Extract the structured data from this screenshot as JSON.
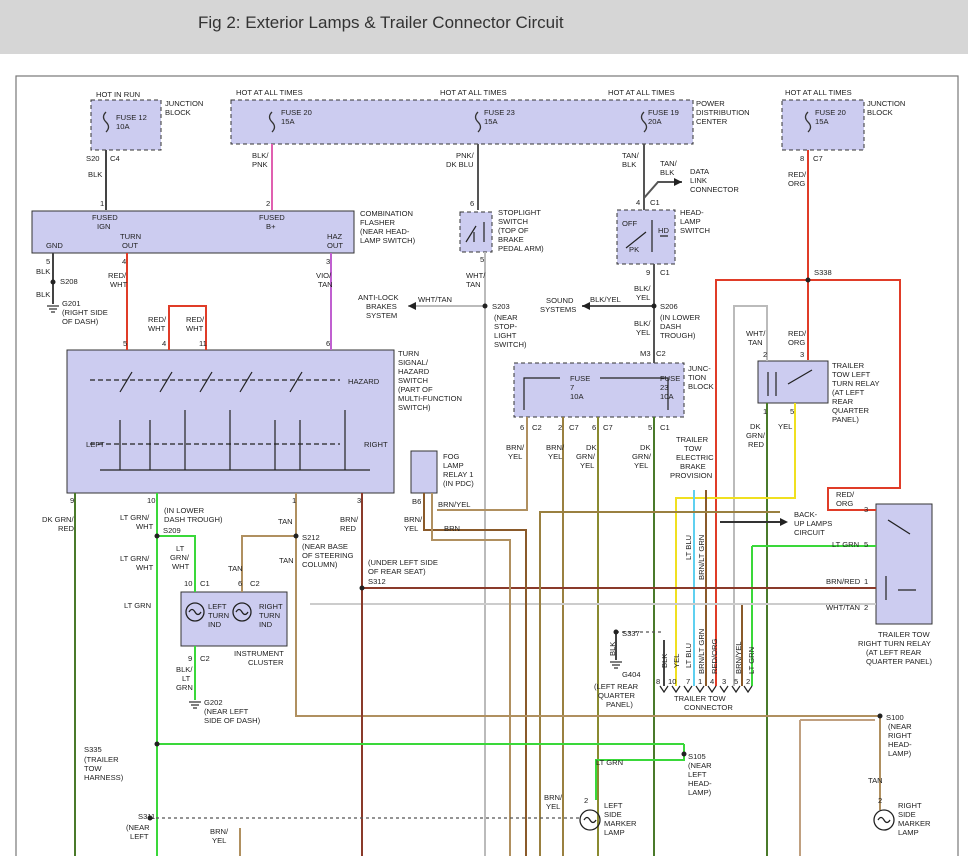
{
  "title": "Fig 2: Exterior Lamps & Trailer Connector Circuit",
  "colors": {
    "box_fill": "#ccccf0",
    "wire_black": "#444444",
    "wire_pink": "#e060b0",
    "wire_red": "#e03c28",
    "wire_tan": "#b09060",
    "wire_brown": "#8a5a2a",
    "wire_green": "#3ad83a",
    "wire_yellow": "#f0e020",
    "wire_lightblue": "#5fd0f0",
    "wire_darkgreen": "#4a7a2a",
    "wire_gray": "#c0c0c0"
  },
  "labels": {
    "hot_in_run": "HOT IN RUN",
    "hot1": "HOT AT ALL TIMES",
    "hot2": "HOT AT ALL TIMES",
    "hot3": "HOT AT ALL TIMES",
    "hot4": "HOT AT ALL TIMES",
    "jb1_a": "JUNCTION",
    "jb1_b": "BLOCK",
    "fuse12_a": "FUSE 12",
    "fuse12_b": "10A",
    "fuse20_a": "FUSE 20",
    "fuse20_b": "15A",
    "fuse23_a": "FUSE 23",
    "fuse23_b": "15A",
    "fuse19_a": "FUSE 19",
    "fuse19_b": "20A",
    "pdc_a": "POWER",
    "pdc_b": "DISTRIBUTION",
    "pdc_c": "CENTER",
    "jb2_a": "JUNCTION",
    "jb2_b": "BLOCK",
    "fuse20r_a": "FUSE 20",
    "fuse20r_b": "15A",
    "s20": "S20",
    "c4": "C4",
    "blk1": "BLK",
    "blkpnk_a": "BLK/",
    "blkpnk_b": "PNK",
    "pnkdkblu_a": "PNK/",
    "pnkdkblu_b": "DK BLU",
    "tanblk_a": "TAN/",
    "tanblk_b": "BLK",
    "tanblk2_a": "TAN/",
    "tanblk2_b": "BLK",
    "dlc_a": "DATA",
    "dlc_b": "LINK",
    "dlc_c": "CONNECTOR",
    "c7a": "C7",
    "p8": "8",
    "redorg_a": "RED/",
    "redorg_b": "ORG",
    "flasher_fused_ign_a": "FUSED",
    "flasher_fused_ign_b": "IGN",
    "flasher_fused_b_a": "FUSED",
    "flasher_fused_b_b": "B+",
    "flasher_gnd": "GND",
    "flasher_turn_a": "TURN",
    "flasher_turn_b": "OUT",
    "flasher_haz_a": "HAZ",
    "flasher_haz_b": "OUT",
    "comb_a": "COMBINATION",
    "comb_b": "FLASHER",
    "comb_c": "(NEAR HEAD-",
    "comb_d": "LAMP SWITCH)",
    "p1": "1",
    "p2": "2",
    "p5a": "5",
    "p4a": "4",
    "p3a": "3",
    "stop_a": "STOPLIGHT",
    "stop_b": "SWITCH",
    "stop_c": "(TOP OF",
    "stop_d": "BRAKE",
    "stop_e": "PEDAL ARM)",
    "p6s": "6",
    "p5s": "5",
    "head_a": "HEAD-",
    "head_b": "LAMP",
    "head_c": "SWITCH",
    "off": "OFF",
    "pk": "PK",
    "hd": "HD",
    "p4h": "4",
    "c1h": "C1",
    "p9h": "9",
    "c1h2": "C1",
    "blk_g1": "BLK",
    "s208": "S208",
    "blk_g2": "BLK",
    "g201_a": "G201",
    "g201_b": "(RIGHT SIDE",
    "g201_c": "OF DASH)",
    "redwht1_a": "RED/",
    "redwht1_b": "WHT",
    "viotan_a": "VIO/",
    "viotan_b": "TAN",
    "whttan1_a": "WHT/",
    "whttan1_b": "TAN",
    "abs_a": "ANTI-LOCK",
    "abs_b": "BRAKES",
    "abs_c": "SYSTEM",
    "whttan_h": "WHT/TAN",
    "s203": "S203",
    "s203_a": "(NEAR",
    "s203_b": "STOP-",
    "s203_c": "LIGHT",
    "s203_d": "SWITCH)",
    "sound_a": "SOUND",
    "sound_b": "SYSTEMS",
    "blkyel_h": "BLK/YEL",
    "blkyel1_a": "BLK/",
    "blkyel1_b": "YEL",
    "blkyel2_a": "BLK/",
    "blkyel2_b": "YEL",
    "s206": "S206",
    "s206_a": "(IN LOWER",
    "s206_b": "DASH",
    "s206_c": "TROUGH)",
    "s338": "S338",
    "redwht2_a": "RED/",
    "redwht2_b": "WHT",
    "redwht3_a": "RED/",
    "redwht3_b": "WHT",
    "p5t": "5",
    "p4t": "4",
    "p11t": "11",
    "p6t": "6",
    "turn_a": "TURN",
    "turn_b": "SIGNAL/",
    "turn_c": "HAZARD",
    "turn_d": "SWITCH",
    "turn_e": "(PART OF",
    "turn_f": "MULTI-FUNCTION",
    "turn_g": "SWITCH)",
    "hazard": "HAZARD",
    "left": "LEFT",
    "right": "RIGHT",
    "m3": "M3",
    "c2m": "C2",
    "jb3_a": "JUNC-",
    "jb3_b": "TION",
    "jb3_c": "BLOCK",
    "fuse7_a": "FUSE",
    "fuse7_b": "7",
    "fuse7_c": "10A",
    "fuse23b_a": "FUSE",
    "fuse23b_b": "23",
    "fuse23b_c": "10A",
    "p6j": "6",
    "c2j": "C2",
    "p2j": "2",
    "c7j": "C7",
    "p6j2": "6",
    "c7j2": "C7",
    "p5j": "5",
    "c1j": "C1",
    "whttan3_a": "WHT/",
    "whttan3_b": "TAN",
    "redorg2_a": "RED/",
    "redorg2_b": "ORG",
    "p2r": "2",
    "p3r": "3",
    "p1r": "1",
    "p5r": "5",
    "tltr_a": "TRAILER",
    "tltr_b": "TOW LEFT",
    "tltr_c": "TURN RELAY",
    "tltr_d": "(AT LEFT",
    "tltr_e": "REAR",
    "tltr_f": "QUARTER",
    "tltr_g": "PANEL)",
    "dkgrnred_a": "DK",
    "dkgrnred_b": "GRN/",
    "dkgrnred_c": "RED",
    "yel1": "YEL",
    "trailerbrake_a": "TRAILER",
    "trailerbrake_b": "TOW",
    "trailerbrake_c": "ELECTRIC",
    "trailerbrake_d": "BRAKE",
    "trailerbrake_e": "PROVISION",
    "brnyel_a": "BRN/",
    "brnyel_b": "YEL",
    "brnyel2_a": "BRN/",
    "brnyel2_b": "YEL",
    "dkgrnyel_a": "DK",
    "dkgrnyel_b": "GRN/",
    "dkgrnyel_c": "YEL",
    "dkgrnyel2_a": "DK",
    "dkgrnyel2_b": "GRN/",
    "dkgrnyel2_c": "YEL",
    "fog_a": "FOG",
    "fog_b": "LAMP",
    "fog_c": "RELAY 1",
    "fog_d": "(IN PDC)",
    "b6": "B6",
    "brnyel3": "BRN/YEL",
    "brnyel4_a": "BRN/",
    "brnyel4_b": "YEL",
    "brn1": "BRN",
    "redorg3_a": "RED/",
    "redorg3_b": "ORG",
    "backup_a": "BACK-",
    "backup_b": "UP LAMPS",
    "backup_c": "CIRCUIT",
    "ltgrn5": "LT GRN",
    "brnred": "BRN/RED",
    "whttan2": "WHT/TAN",
    "p3tr": "3",
    "p5tr": "5",
    "p1tr": "1",
    "p2tr": "2",
    "trtr_a": "TRAILER TOW",
    "trtr_b": "RIGHT TURN RELAY",
    "trtr_c": "(AT LEFT REAR",
    "trtr_d": "QUARTER PANEL)",
    "p9": "9",
    "p10": "10",
    "p1b": "1",
    "p3b": "3",
    "dkgrnred2_a": "DK GRN/",
    "dkgrnred2_b": "RED",
    "ltgrnwht_a": "LT GRN/",
    "ltgrnwht_b": "WHT",
    "s209": "S209",
    "s209_a": "(IN LOWER",
    "s209_b": "DASH TROUGH)",
    "tan1": "TAN",
    "brnred2_a": "BRN/",
    "brnred2_b": "RED",
    "s212": "S212",
    "s212_a": "(NEAR BASE",
    "s212_b": "OF STEERING",
    "s212_c": "COLUMN)",
    "tan2": "TAN",
    "s312": "S312",
    "s312_a": "(UNDER LEFT SIDE",
    "s312_b": "OF REAR SEAT)",
    "ltgrnwht2_a": "LT GRN/",
    "ltgrnwht2_b": "WHT",
    "ltgrnwht3_a": "LT",
    "ltgrnwht3_b": "GRN/",
    "ltgrnwht3_c": "WHT",
    "tan3": "TAN",
    "p10c": "10",
    "c1c": "C1",
    "p6c": "6",
    "c2c": "C2",
    "ltgrn1": "LT GRN",
    "lti_a": "LEFT",
    "lti_b": "TURN",
    "lti_c": "IND",
    "rti_a": "RIGHT",
    "rti_b": "TURN",
    "rti_c": "IND",
    "ic_a": "INSTRUMENT",
    "ic_b": "CLUSTER",
    "p9c": "9",
    "c2c2": "C2",
    "blkltgrn_a": "BLK/",
    "blkltgrn_b": "LT",
    "blkltgrn_c": "GRN",
    "g202_a": "G202",
    "g202_b": "(NEAR LEFT",
    "g202_c": "SIDE OF DASH)",
    "s337": "S337",
    "blk_v": "BLK",
    "g404_a": "G404",
    "g404_b": "(LEFT REAR",
    "g404_c": "QUARTER",
    "g404_d": "PANEL)",
    "ltblu_v": "LT BLU",
    "brnltgrn_v": "BRN/LT GRN",
    "blk_v2": "BLK",
    "yel_v2": "YEL",
    "ltblu_v2": "LT BLU",
    "brnltgrn_v2": "BRN/LT GRN",
    "redorg_v": "RED/ORG",
    "brnyel_v": "BRN/YEL",
    "ltgrn_v": "LT GRN",
    "c_p8": "8",
    "c_p10": "10",
    "c_p7": "7",
    "c_p1": "1",
    "c_p4": "4",
    "c_p3": "3",
    "c_p5": "5",
    "c_p2": "2",
    "ttc": "TRAILER TOW",
    "ttc2": "CONNECTOR",
    "s100": "S100",
    "s100_a": "(NEAR",
    "s100_b": "RIGHT",
    "s100_c": "HEAD-",
    "s100_d": "LAMP)",
    "s335": "S335",
    "s335_a": "(TRAILER",
    "s335_b": "TOW",
    "s335_c": "HARNESS)",
    "s105": "S105",
    "s105_a": "(NEAR",
    "s105_b": "LEFT",
    "s105_c": "HEAD-",
    "s105_d": "LAMP)",
    "ltgrn2": "LT GRN",
    "tan4": "TAN",
    "s311": "S311",
    "s311_a": "(NEAR",
    "s311_b": "LEFT",
    "brnyel5_a": "BRN/",
    "brnyel5_b": "YEL",
    "brnyel6_a": "BRN/",
    "brnyel6_b": "YEL",
    "p2m": "2",
    "lsml_a": "LEFT",
    "lsml_b": "SIDE",
    "lsml_c": "MARKER",
    "lsml_d": "LAMP",
    "p2rm": "2",
    "rsml_a": "RIGHT",
    "rsml_b": "SIDE",
    "rsml_c": "MARKER",
    "rsml_d": "LAMP"
  }
}
